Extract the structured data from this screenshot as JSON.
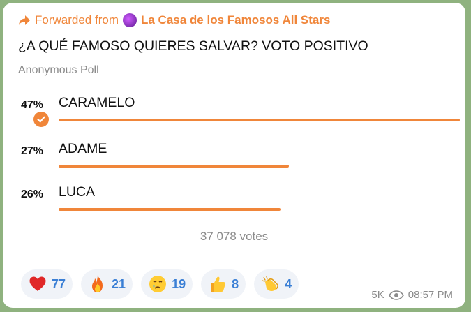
{
  "forward": {
    "prefix": "Forwarded from",
    "channel": "La Casa de los Famosos All Stars"
  },
  "poll": {
    "question": "¿A QUÉ FAMOSO QUIERES SALVAR? VOTO POSITIVO",
    "type": "Anonymous Poll",
    "options": [
      {
        "percent": "47%",
        "label": "CARAMELO",
        "share": 0.47,
        "chosen": true
      },
      {
        "percent": "27%",
        "label": "ADAME",
        "share": 0.27,
        "chosen": false
      },
      {
        "percent": "26%",
        "label": "LUCA",
        "share": 0.26,
        "chosen": false
      }
    ],
    "votes": "37 078 votes"
  },
  "reactions": [
    {
      "icon": "red-heart-icon",
      "count": "77"
    },
    {
      "icon": "fire-icon",
      "count": "21"
    },
    {
      "icon": "crying-face-icon",
      "count": "19"
    },
    {
      "icon": "thumbs-up-icon",
      "count": "8"
    },
    {
      "icon": "clapping-hands-icon",
      "count": "4"
    }
  ],
  "meta": {
    "views": "5K",
    "time": "08:57 PM"
  },
  "colors": {
    "accent": "#f0863a",
    "reaction_count": "#3a7fd5",
    "muted": "#8b8b8b"
  }
}
